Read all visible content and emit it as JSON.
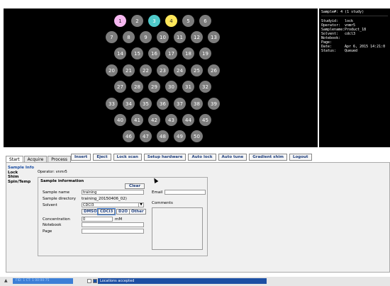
{
  "tray": {
    "rows": [
      [
        "1",
        "2",
        "3",
        "4",
        "5",
        "6"
      ],
      [
        "7",
        "8",
        "9",
        "10",
        "11",
        "12",
        "13"
      ],
      [
        "14",
        "15",
        "16",
        "17",
        "18",
        "19"
      ],
      [
        "20",
        "21",
        "22",
        "23",
        "24",
        "25",
        "26"
      ],
      [
        "27",
        "28",
        "29",
        "30",
        "31",
        "32"
      ],
      [
        "33",
        "34",
        "35",
        "36",
        "37",
        "38",
        "39"
      ],
      [
        "40",
        "41",
        "42",
        "43",
        "44",
        "45"
      ],
      [
        "46",
        "47",
        "48",
        "49",
        "50"
      ]
    ],
    "highlighted": {
      "1": "pink",
      "3": "cyan",
      "4": "yellow"
    }
  },
  "sample_panel": {
    "title": "Sample#: 4   (1 study)",
    "rows": [
      {
        "k": "Studyid:",
        "v": "lock"
      },
      {
        "k": "Operator:",
        "v": "vnmr5"
      },
      {
        "k": "Samplename:",
        "v": "Product_18"
      },
      {
        "k": "Solvent:",
        "v": "cdcl3"
      },
      {
        "k": "Notebook:",
        "v": ""
      },
      {
        "k": "Page:",
        "v": ""
      },
      {
        "k": "Date:",
        "v": "Apr 6, 2015 14:21:0"
      },
      {
        "k": "Status:",
        "v": "Queued"
      }
    ]
  },
  "tabs": [
    "Start",
    "Acquire",
    "Process"
  ],
  "toolbar": [
    "Insert",
    "Eject",
    "Lock scan",
    "Setup hardware",
    "Auto lock",
    "Auto tune",
    "Gradient shim",
    "Logout"
  ],
  "sidenav": [
    "Sample Info",
    "Lock",
    "Shim",
    "Spin/Temp"
  ],
  "operator_label": "Operator: vnmr5",
  "sample_info": {
    "legend": "Sample information",
    "clear": "Clear",
    "sample_name_label": "Sample name",
    "sample_name_value": "training",
    "sample_dir_label": "Sample directory",
    "sample_dir_value": "training_20150406_02)",
    "solvent_label": "Solvent",
    "solvent_value": "CDCl3",
    "solvent_buttons": [
      "DMSO",
      "CDCl3",
      "D2O",
      "Other"
    ],
    "concentration_label": "Concentration",
    "concentration_value": "0",
    "concentration_unit": "mM",
    "notebook_label": "Notebook",
    "page_label": "Page",
    "email_label": "Email",
    "comments_label": "Comments"
  },
  "status": {
    "progress_text": "FID: 1  CT: 1  00:00:75",
    "message": "Locations accepted",
    "warning_icon": "warning-icon"
  }
}
